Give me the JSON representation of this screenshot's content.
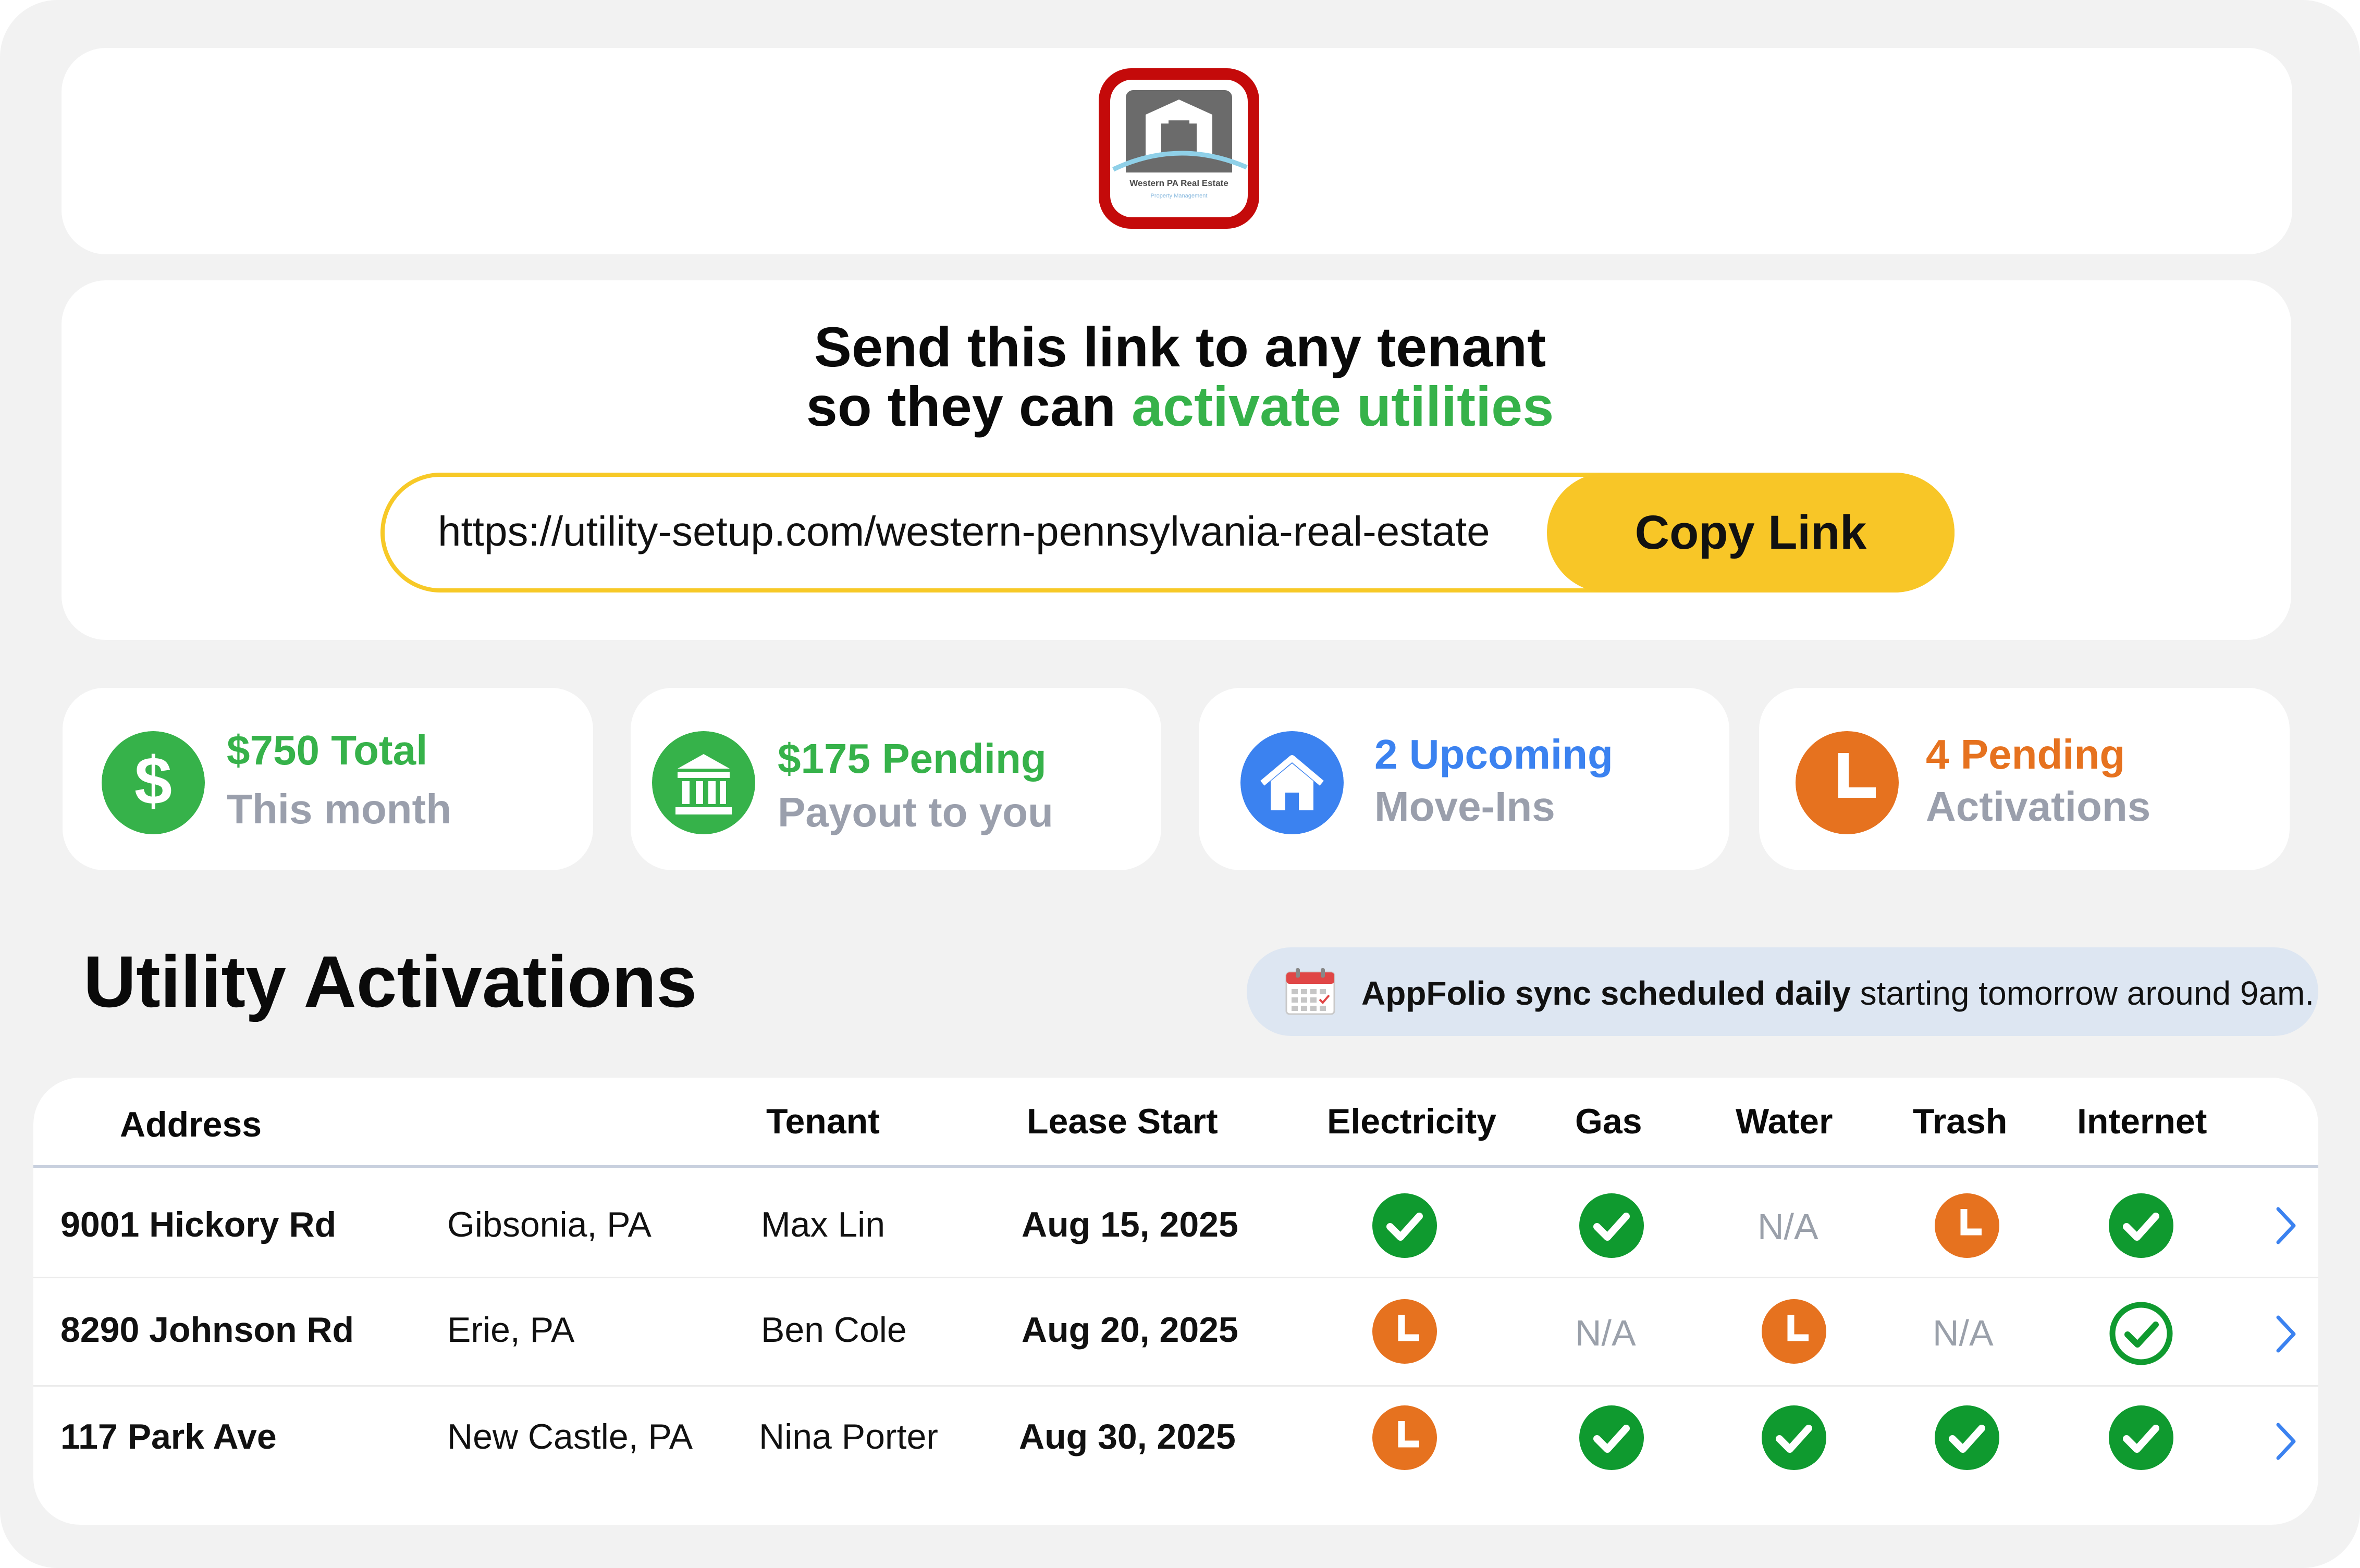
{
  "logo": {
    "brand": "Western PA Real Estate",
    "sub": "Property Management"
  },
  "share": {
    "headline_line1": "Send this link to any tenant",
    "headline_line2_prefix": "so they can ",
    "headline_line2_accent": "activate utilities",
    "link": "https://utility-setup.com/western-pennsylvania-real-estate",
    "copy_label": "Copy Link"
  },
  "stats": [
    {
      "value": "$750 Total",
      "label": "This month",
      "color": "#36b24a",
      "icon": "dollar-icon"
    },
    {
      "value": "$175 Pending",
      "label": "Payout to you",
      "color": "#36b24a",
      "icon": "bank-icon"
    },
    {
      "value": "2 Upcoming",
      "label": "Move-Ins",
      "color": "#3b82f0",
      "icon": "home-icon"
    },
    {
      "value": "4 Pending",
      "label": "Activations",
      "color": "#e6721f",
      "icon": "clock-icon"
    }
  ],
  "section": {
    "title": "Utility Activations",
    "sync_bold": "AppFolio sync scheduled daily",
    "sync_rest": " starting tomorrow around 9am."
  },
  "table": {
    "headers": [
      "Address",
      "Tenant",
      "Lease Start",
      "Electricity",
      "Gas",
      "Water",
      "Trash",
      "Internet"
    ],
    "rows": [
      {
        "address": "9001 Hickory Rd",
        "city": "Gibsonia, PA",
        "tenant": "Max Lin",
        "lease": "Aug 15, 2025",
        "statuses": [
          "done",
          "done",
          "na",
          "pending",
          "done"
        ]
      },
      {
        "address": "8290 Johnson Rd",
        "city": "Erie, PA",
        "tenant": "Ben Cole",
        "lease": "Aug 20, 2025",
        "statuses": [
          "pending",
          "na",
          "pending",
          "na",
          "outline"
        ]
      },
      {
        "address": "117 Park Ave",
        "city": "New Castle, PA",
        "tenant": "Nina Porter",
        "lease": "Aug 30, 2025",
        "statuses": [
          "pending",
          "done",
          "done",
          "done",
          "done"
        ]
      }
    ],
    "na_label": "N/A"
  },
  "colors": {
    "green": "#0f9a2f",
    "orange": "#e6721f",
    "blue": "#3b82f0",
    "yellow": "#f8c627"
  }
}
